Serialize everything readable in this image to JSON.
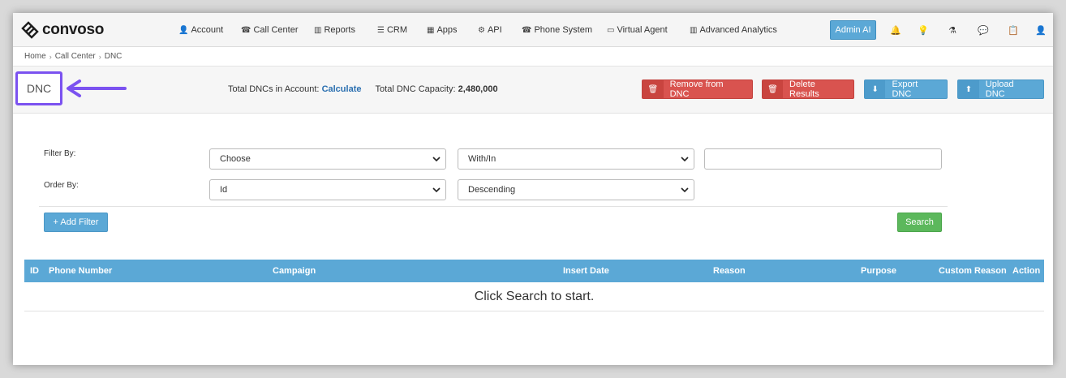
{
  "brand": {
    "name": "convoso"
  },
  "nav": [
    {
      "icon": "user-icon",
      "glyph": "👤",
      "label": "Account"
    },
    {
      "icon": "phone-icon",
      "glyph": "☎",
      "label": "Call Center"
    },
    {
      "icon": "bar-chart-icon",
      "glyph": "▥",
      "label": "Reports"
    },
    {
      "icon": "list-icon",
      "glyph": "☰",
      "label": "CRM"
    },
    {
      "icon": "grid-icon",
      "glyph": "▦",
      "label": "Apps"
    },
    {
      "icon": "gear-icon",
      "glyph": "⚙",
      "label": "API"
    },
    {
      "icon": "phone-icon",
      "glyph": "☎",
      "label": "Phone System"
    },
    {
      "icon": "monitor-icon",
      "glyph": "▭",
      "label": "Virtual Agent"
    },
    {
      "icon": "bar-chart-icon",
      "glyph": "▥",
      "label": "Advanced Analytics"
    }
  ],
  "admin_button": "Admin AI",
  "tools": [
    {
      "icon": "bell-icon",
      "glyph": "🔔"
    },
    {
      "icon": "lightbulb-icon",
      "glyph": "💡"
    },
    {
      "icon": "flask-icon",
      "glyph": "⚗"
    },
    {
      "icon": "comment-icon",
      "glyph": "💬"
    },
    {
      "icon": "clipboard-icon",
      "glyph": "📋"
    },
    {
      "icon": "user-icon",
      "glyph": "👤"
    }
  ],
  "breadcrumb": [
    "Home",
    "Call Center",
    "DNC"
  ],
  "page_title": "DNC",
  "totals": {
    "dncs_label": "Total DNCs in Account:",
    "dncs_link": "Calculate",
    "capacity_label": "Total DNC Capacity:",
    "capacity_value": "2,480,000"
  },
  "actions": {
    "remove": "Remove from DNC",
    "delete": "Delete Results",
    "export": "Export DNC",
    "upload": "Upload DNC"
  },
  "filters": {
    "filter_by_label": "Filter By:",
    "order_by_label": "Order By:",
    "field_select": "Choose",
    "operator_select": "With/In",
    "value_input": "",
    "order_field_select": "Id",
    "order_direction_select": "Descending",
    "add_filter": "+ Add Filter",
    "search": "Search"
  },
  "table": {
    "columns": [
      "ID",
      "Phone Number",
      "Campaign",
      "Insert Date",
      "Reason",
      "Purpose",
      "Custom Reason",
      "Action"
    ],
    "empty_message": "Click Search to start."
  },
  "colors": {
    "accent_blue": "#5ba8d6",
    "danger_red": "#d9534f",
    "success_green": "#5cb85c",
    "highlight_purple": "#7b52f0"
  }
}
